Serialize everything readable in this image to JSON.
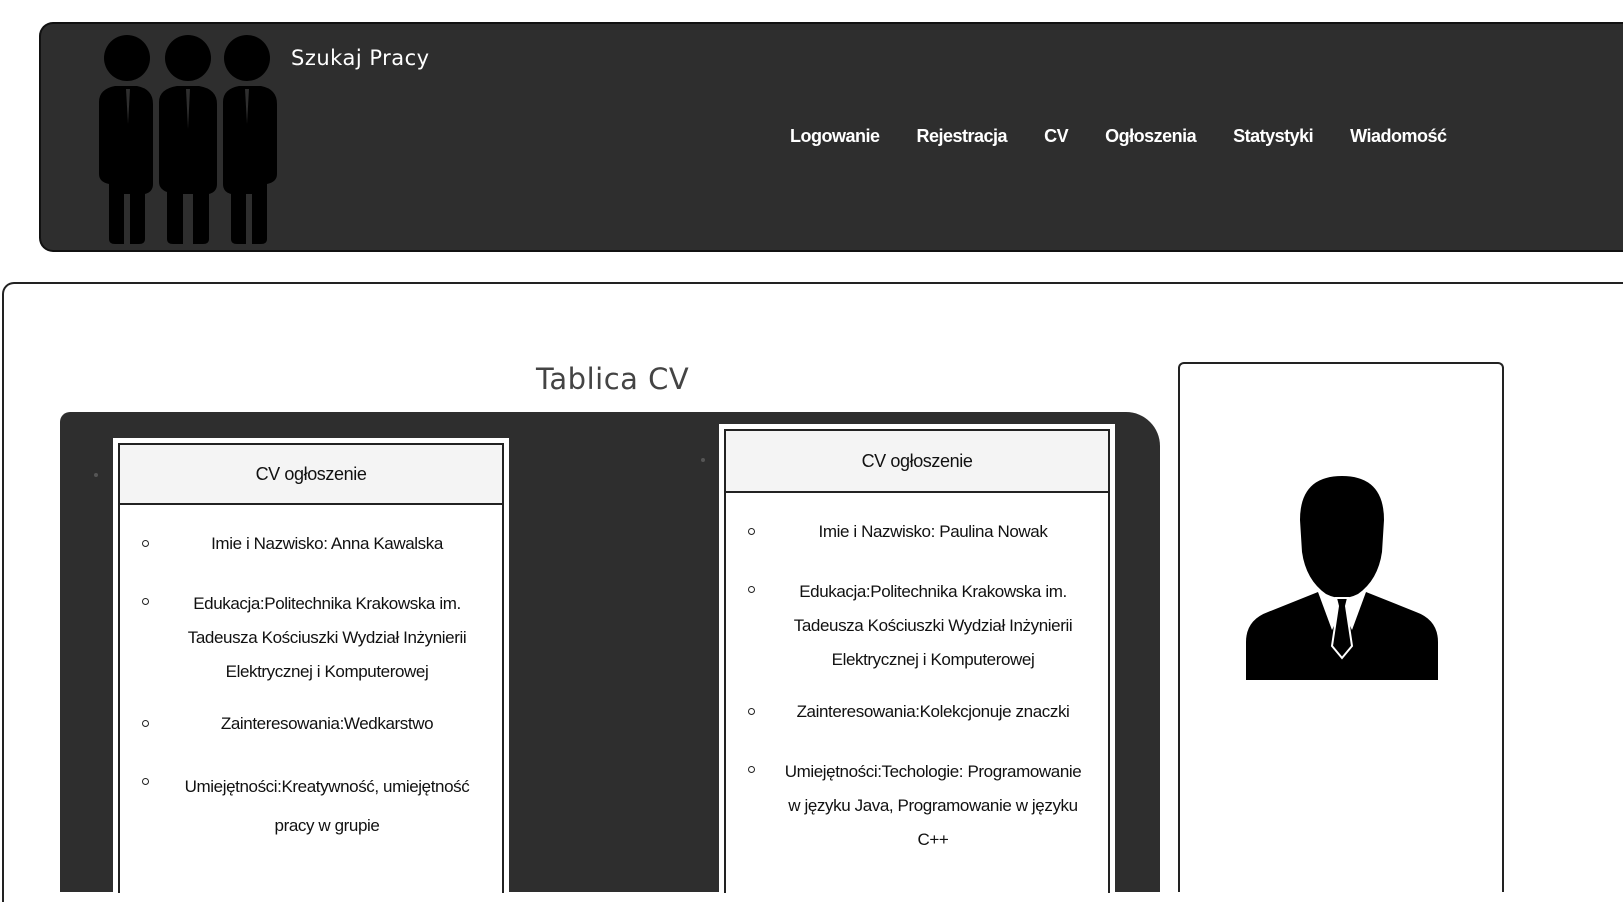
{
  "header": {
    "site_title": "Szukaj Pracy",
    "logo_icon": "business-team-icon",
    "nav": [
      {
        "label": "Logowanie"
      },
      {
        "label": "Rejestracja"
      },
      {
        "label": "CV"
      },
      {
        "label": "Ogłoszenia"
      },
      {
        "label": "Statystyki"
      },
      {
        "label": "Wiadomość"
      }
    ]
  },
  "main": {
    "title": "Tablica CV",
    "cards": [
      {
        "header": "CV ogłoszenie",
        "items": [
          "Imie i Nazwisko: Anna Kawalska",
          "Edukacja:Politechnika Krakowska im. Tadeusza Kościuszki Wydział Inżynierii Elektrycznej i Komputerowej",
          "Zainteresowania:Wedkarstwo",
          "Umiejętności:Kreatywność, umiejętność pracy w grupie"
        ]
      },
      {
        "header": "CV ogłoszenie",
        "items": [
          "Imie i Nazwisko: Paulina Nowak",
          "Edukacja:Politechnika Krakowska im. Tadeusza Kościuszki Wydział Inżynierii Elektrycznej i Komputerowej",
          "Zainteresowania:Kolekcjonuje znaczki",
          "Umiejętności:Techologie: Programowanie w języku Java, Programowanie w języku C++"
        ]
      }
    ]
  },
  "sidebar": {
    "avatar_icon": "user-avatar-icon"
  },
  "colors": {
    "header_bg": "#2e2e2e",
    "board_bg": "#2e2e2e",
    "text_light": "#ffffff"
  }
}
